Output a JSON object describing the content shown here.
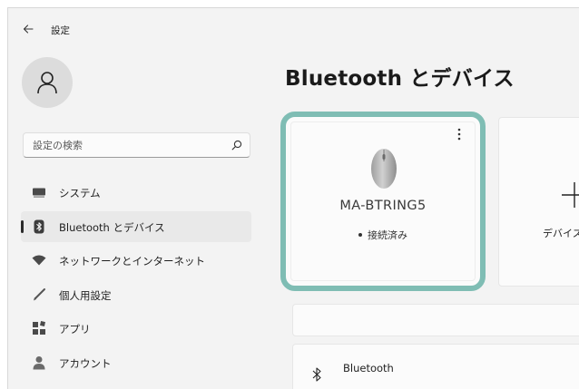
{
  "window": {
    "title": "設定",
    "back_icon": "back-arrow-icon"
  },
  "account": {
    "avatar_icon": "user-icon"
  },
  "search": {
    "placeholder": "設定の検索",
    "icon": "search-icon"
  },
  "sidebar": {
    "items": [
      {
        "label": "システム",
        "icon": "system-monitor-icon",
        "selected": false
      },
      {
        "label": "Bluetooth とデバイス",
        "icon": "bluetooth-devices-icon",
        "selected": true
      },
      {
        "label": "ネットワークとインターネット",
        "icon": "wifi-icon",
        "selected": false
      },
      {
        "label": "個人用設定",
        "icon": "brush-icon",
        "selected": false
      },
      {
        "label": "アプリ",
        "icon": "apps-icon",
        "selected": false
      },
      {
        "label": "アカウント",
        "icon": "account-icon",
        "selected": false
      }
    ]
  },
  "main": {
    "title": "Bluetooth とデバイス",
    "device_card": {
      "name": "MA-BTRING5",
      "status": "接続済み",
      "icon": "mouse-icon",
      "highlight_color": "#7fbdb4"
    },
    "add_device": {
      "label": "デバイスの",
      "icon": "plus-icon"
    },
    "bluetooth_row": {
      "label": "Bluetooth",
      "icon": "bluetooth-icon"
    }
  }
}
